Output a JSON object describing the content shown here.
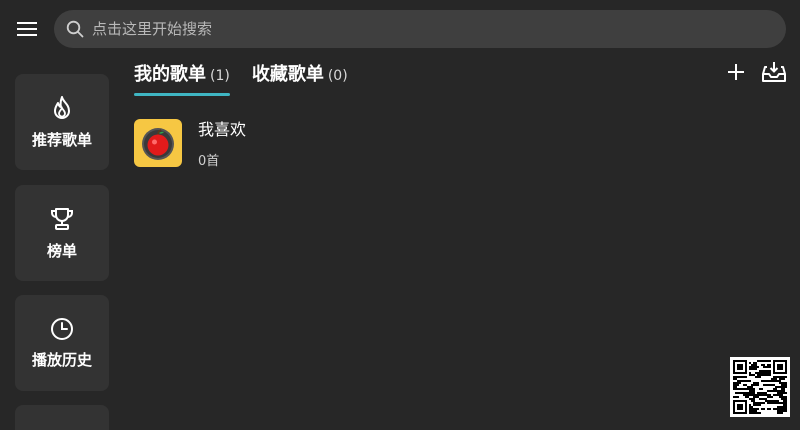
{
  "header": {
    "menu_icon": "hamburger-menu-icon",
    "search_placeholder": "点击这里开始搜索"
  },
  "sidebar": {
    "items": [
      {
        "label": "推荐歌单",
        "icon": "fire-icon"
      },
      {
        "label": "榜单",
        "icon": "trophy-icon"
      },
      {
        "label": "播放历史",
        "icon": "clock-icon"
      }
    ]
  },
  "tabs": [
    {
      "label": "我的歌单",
      "count": "(1)",
      "active": true
    },
    {
      "label": "收藏歌单",
      "count": "(0)",
      "active": false
    }
  ],
  "actions": {
    "add_icon": "plus-icon",
    "import_icon": "inbox-download-icon"
  },
  "playlists": [
    {
      "name": "我喜欢",
      "count": "0首",
      "cover_color": "#f6c743"
    }
  ],
  "colors": {
    "background": "#272727",
    "accent": "#3fb6c3",
    "card": "#333333",
    "search_bg": "#3f3f3f"
  }
}
